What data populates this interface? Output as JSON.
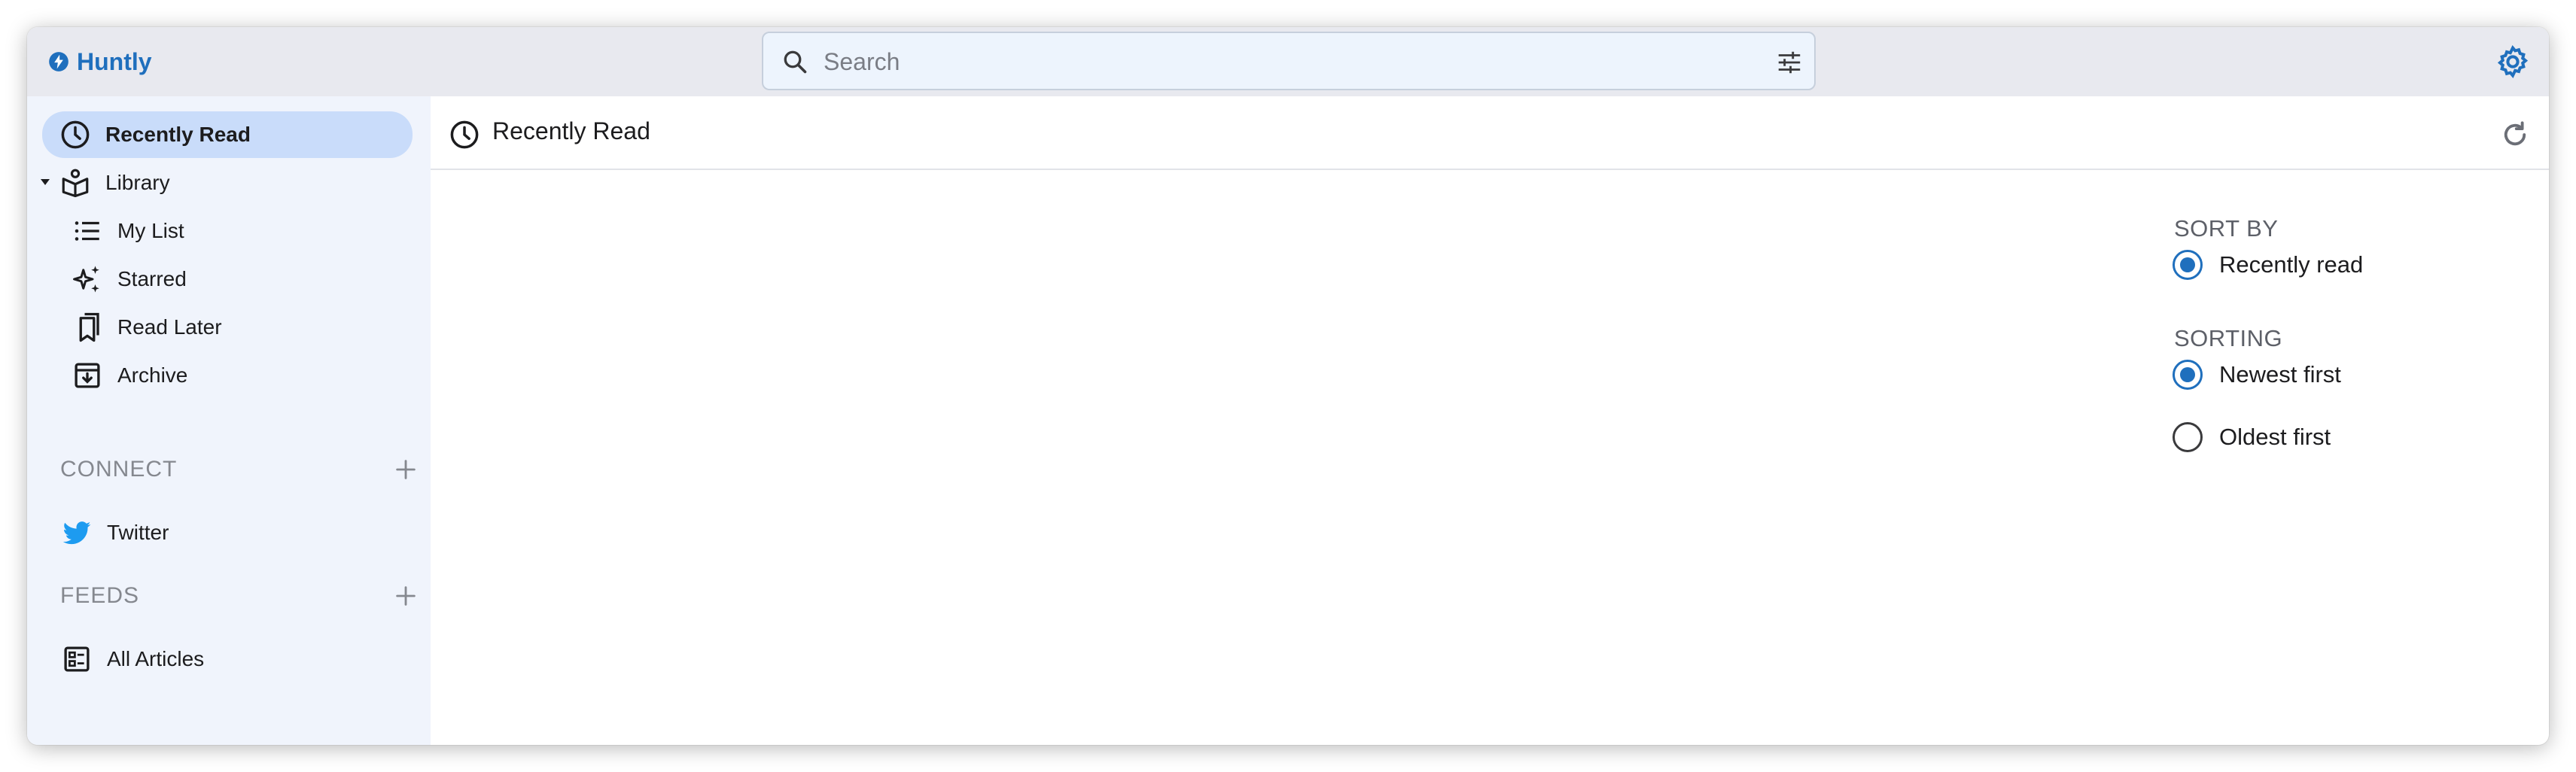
{
  "app": {
    "name": "Huntly",
    "brand_color": "#1f6fbd"
  },
  "search": {
    "placeholder": "Search",
    "value": ""
  },
  "sidebar": {
    "recently_read": {
      "label": "Recently Read",
      "icon": "clock-icon",
      "active": true
    },
    "library": {
      "label": "Library",
      "icon": "library-icon",
      "expanded": true,
      "items": [
        {
          "label": "My List",
          "icon": "list-icon"
        },
        {
          "label": "Starred",
          "icon": "sparkle-icon"
        },
        {
          "label": "Read Later",
          "icon": "bookmarks-icon"
        },
        {
          "label": "Archive",
          "icon": "archive-icon"
        }
      ]
    },
    "connect": {
      "heading": "CONNECT",
      "items": [
        {
          "label": "Twitter",
          "icon": "twitter-icon",
          "color": "#1d9bf0"
        }
      ]
    },
    "feeds": {
      "heading": "FEEDS",
      "items": [
        {
          "label": "All Articles",
          "icon": "articles-icon"
        }
      ]
    }
  },
  "main": {
    "title": "Recently Read",
    "icon": "clock-icon"
  },
  "sort": {
    "sort_by_heading": "SORT BY",
    "sort_by_options": [
      {
        "label": "Recently read",
        "selected": true
      }
    ],
    "sorting_heading": "SORTING",
    "sorting_options": [
      {
        "label": "Newest first",
        "selected": true
      },
      {
        "label": "Oldest first",
        "selected": false
      }
    ]
  }
}
